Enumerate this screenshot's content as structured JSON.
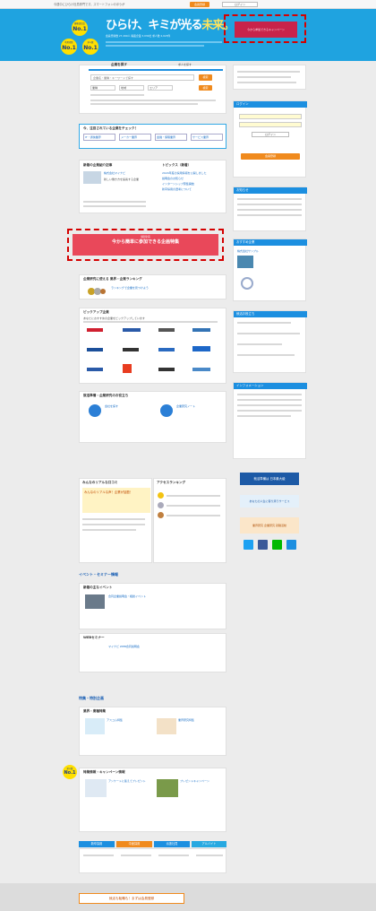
{
  "topbar": {
    "note": "今週中にひらけ社員専門です。スマートフォンのほうが",
    "login_label": "ログイン",
    "register_label": "会員登録"
  },
  "hero": {
    "badge1_small": "顧客満足度",
    "badge1": "No.1",
    "badge2_small": "利用者数",
    "badge2": "No.1",
    "badge3_small": "求人数",
    "badge3": "No.1",
    "logo_main": "ひらけ、キミが光る",
    "logo_accent": "未来。",
    "stats_line": "会員登録数 27,490人 掲載企業 3,030社 求人数 4,023件",
    "ad_text": "今から参加できるキャンペーン"
  },
  "search": {
    "tab_active": "企業を探す",
    "tab_inactive": "求人を探す",
    "placeholder": "企業名・業種・キーワードで探す",
    "button": "検索",
    "select1": "業種",
    "select2": "地域",
    "select3": "エリア",
    "button2": "検索"
  },
  "section_popular": {
    "title": "今、注目されている企業をチェック！",
    "chips": [
      "IT・通信業界",
      "メーカー業界",
      "金融・保険業界",
      "サービス業界"
    ]
  },
  "section_news": {
    "title": "新着の企業紹介記事",
    "item_title": "株式会社マイナビ",
    "item_desc": "新しい働き方を提案する企業",
    "topics_title": "トピックス（新着）",
    "topics": [
      "2024年度の採用情報を公開しました",
      "説明会のお知らせ",
      "インターンシップ募集開始",
      "新卒採用の選考について"
    ]
  },
  "banner_mid": {
    "label": "特別企画",
    "text": "今から簡単に参加できる企画特集"
  },
  "ranking": {
    "title": "企業研究に使える 業界・企業ランキング",
    "desc": "ランキングで企業を見つけよう"
  },
  "pickup": {
    "title": "ピックアップ企業",
    "desc": "あなたにおすすめの企業をピックアップしています"
  },
  "guide": {
    "title": "就活準備・企業研究のお役立ち",
    "item1": "会社を探す",
    "item2": "企業研究ノート"
  },
  "voice": {
    "title": "みんなのリアルな口コミ",
    "banner_text": "みんなのリアルな声！企業が話題！",
    "ranking_title": "アクセスランキング"
  },
  "events": {
    "section_title": "イベント・セミナー情報",
    "title1": "新着の主なイベント",
    "event_title": "合同企業説明会・相談イベント",
    "title2": "WEBセミナー",
    "seminar_title": "マイナビ WEB合同説明会"
  },
  "features": {
    "section_title": "特集・特別企画",
    "title1": "業界・業種特集",
    "item1": "アスコム特集",
    "item2": "業界研究特集"
  },
  "special": {
    "badge_small": "求人数",
    "badge": "No.1",
    "title": "特集情報・キャンペーン情報",
    "item1": "アンケートに答えてプレゼント",
    "item2": "プレゼントキャンペーン"
  },
  "bottom_tabs": [
    "新卒採用",
    "中途採用",
    "派遣社員",
    "アルバイト"
  ],
  "sidebar": {
    "login_head": "ログイン",
    "login_button": "ログイン",
    "register_button": "会員登録",
    "news_head": "お知らせ",
    "company_head": "おすすめ企業",
    "company_name": "株式会社サンプル",
    "link_head": "就活お役立ち",
    "info_head": "インフォメーション",
    "banner1": "就活準備は 日本最大級",
    "banner2": "あなたの人生に寄り添うサービス",
    "banner3": "業界研究 企業研究 就職活動"
  },
  "footer_banner": "就活も転職も！まずは会員登録"
}
